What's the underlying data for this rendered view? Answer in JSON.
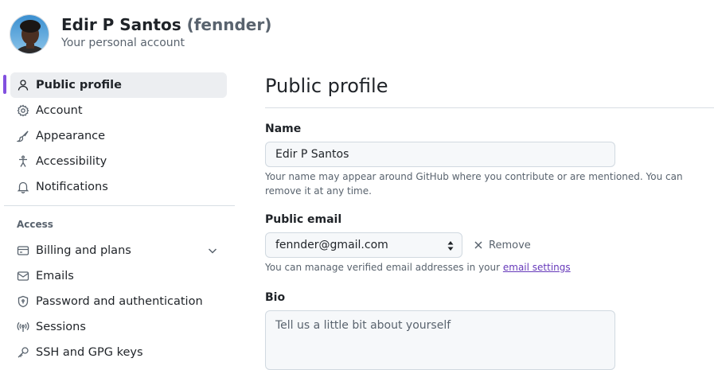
{
  "header": {
    "display_name": "Edir P Santos",
    "login": "(fennder)",
    "subtitle": "Your personal account"
  },
  "sidebar": {
    "items": [
      {
        "label": "Public profile",
        "icon": "person-icon",
        "active": true
      },
      {
        "label": "Account",
        "icon": "gear-icon"
      },
      {
        "label": "Appearance",
        "icon": "paintbrush-icon"
      },
      {
        "label": "Accessibility",
        "icon": "accessibility-icon"
      },
      {
        "label": "Notifications",
        "icon": "bell-icon"
      }
    ],
    "access_heading": "Access",
    "access_items": [
      {
        "label": "Billing and plans",
        "icon": "credit-card-icon",
        "expandable": true
      },
      {
        "label": "Emails",
        "icon": "mail-icon"
      },
      {
        "label": "Password and authentication",
        "icon": "shield-lock-icon"
      },
      {
        "label": "Sessions",
        "icon": "broadcast-icon"
      },
      {
        "label": "SSH and GPG keys",
        "icon": "key-icon"
      }
    ]
  },
  "main": {
    "title": "Public profile",
    "name": {
      "label": "Name",
      "value": "Edir P Santos",
      "note": "Your name may appear around GitHub where you contribute or are mentioned. You can remove it at any time."
    },
    "public_email": {
      "label": "Public email",
      "selected": "fennder@gmail.com",
      "remove_label": "Remove",
      "note_prefix": "You can manage verified email addresses in your ",
      "note_link": "email settings"
    },
    "bio": {
      "label": "Bio",
      "placeholder": "Tell us a little bit about yourself"
    }
  },
  "colors": {
    "accent_bar": "#8250df",
    "link": "#6639ba",
    "active_bg": "#eceef1"
  }
}
